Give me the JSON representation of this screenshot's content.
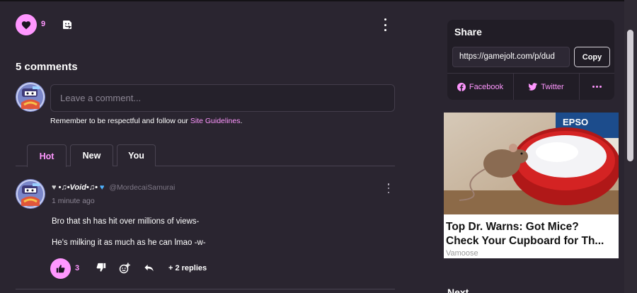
{
  "post_actions": {
    "like_count": "9"
  },
  "comments": {
    "heading": "5 comments",
    "input_placeholder": "Leave a comment...",
    "guidelines_text": "Remember to be respectful and follow our ",
    "guidelines_link": "Site Guidelines",
    "guidelines_end": ".",
    "tabs": [
      "Hot",
      "New",
      "You"
    ],
    "active_tab": "Hot",
    "items": [
      {
        "author": "•♫•Void•♫•",
        "handle": "@MordecaiSamurai",
        "time": "1 minute ago",
        "lines": [
          "Bro that sh has hit over millions of views-",
          "He's milking it as much as he can lmao -w-"
        ],
        "like_count": "3",
        "replies": "+ 2 replies"
      }
    ]
  },
  "share": {
    "title": "Share",
    "url": "https://gamejolt.com/p/dud",
    "copy_label": "Copy",
    "facebook_label": "Facebook",
    "twitter_label": "Twitter"
  },
  "ad": {
    "headline": "Top Dr. Warns: Got Mice? Check Your Cupboard for Th...",
    "headline_line1": "Top Dr. Warns: Got Mice?",
    "headline_line2": "Check Your Cupboard for Th...",
    "source": "Vamoose",
    "box_text": "EPSO"
  },
  "sidebar": {
    "next_heading": "Next"
  },
  "colors": {
    "background": "#2a2530",
    "accent": "#ff97ff",
    "panel": "#211d26"
  }
}
